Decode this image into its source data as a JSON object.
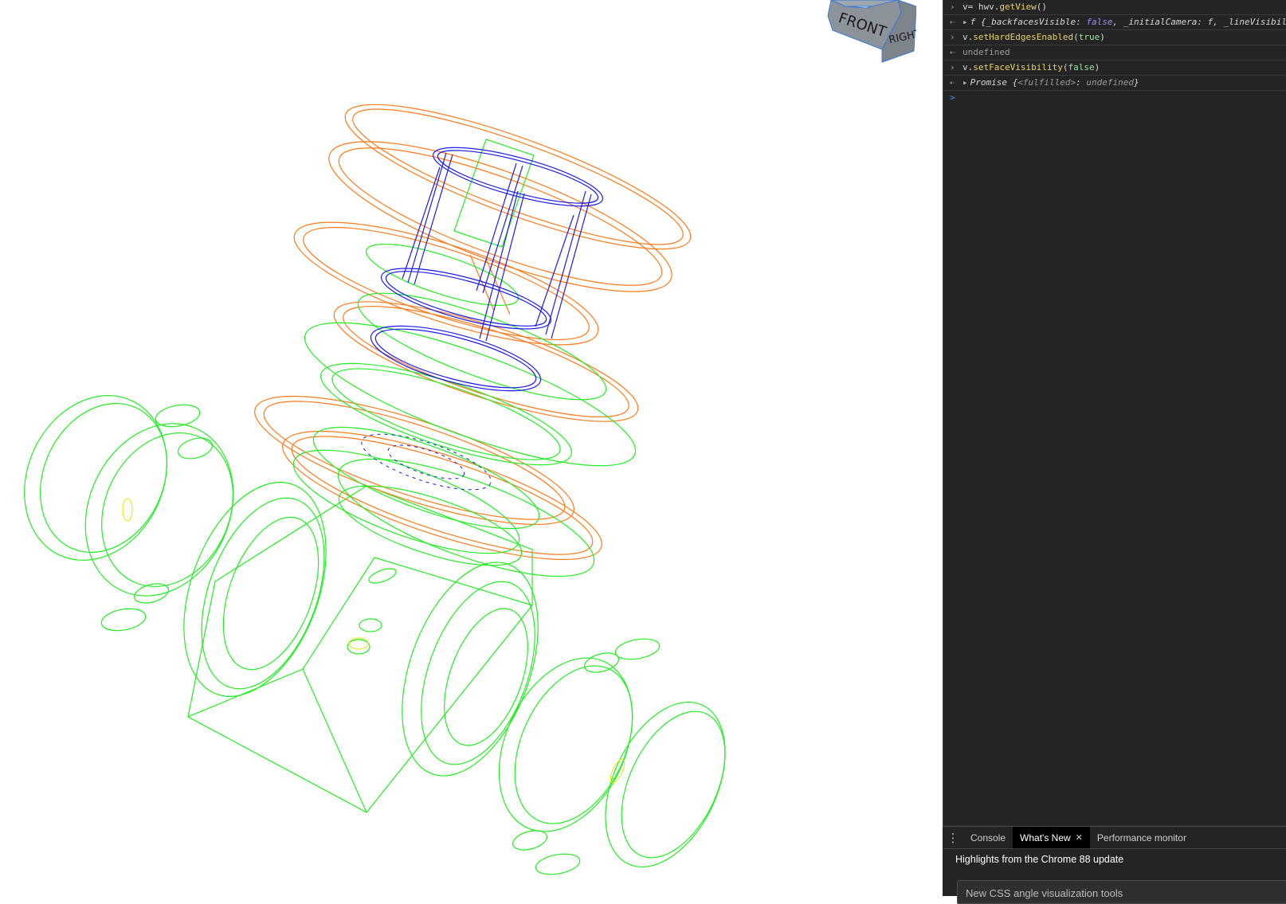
{
  "viewport": {
    "navcube": {
      "front_label": "FRONT",
      "right_label": "RIGHT"
    },
    "edge_colors": {
      "body": "#22ee22",
      "seal": "#ff7a1a",
      "stem": "#1a1aee",
      "detail": "#e6e600"
    }
  },
  "console": {
    "rows": [
      {
        "kind": "in",
        "parts": [
          "v= hwv.",
          "getView",
          "()"
        ]
      },
      {
        "kind": "out",
        "parts": [
          "f {_backfacesVisible: ",
          "false",
          ", _initialCamera: f, _lineVisibili"
        ]
      },
      {
        "kind": "in",
        "parts": [
          "v.",
          "setHardEdgesEnabled",
          "(",
          "true",
          ")"
        ]
      },
      {
        "kind": "out",
        "parts": [
          "undefined"
        ]
      },
      {
        "kind": "in",
        "parts": [
          "v.",
          "setFaceVisibility",
          "(",
          "false",
          ")"
        ]
      },
      {
        "kind": "out",
        "parts": [
          "Promise {",
          "<fulfilled>",
          ": ",
          "undefined",
          "}"
        ]
      }
    ],
    "prompt_symbol": ">"
  },
  "drawer": {
    "menu_icon": "kebab-menu-icon",
    "tabs": [
      "Console",
      "What's New",
      "Performance monitor"
    ],
    "active_tab": "What's New",
    "heading": "Highlights from the Chrome 88 update",
    "card_title": "New CSS angle visualization tools"
  }
}
